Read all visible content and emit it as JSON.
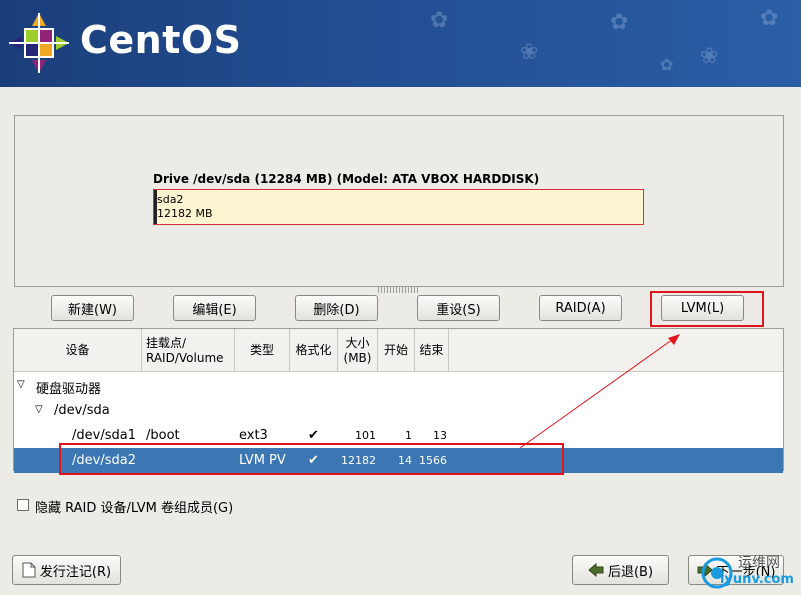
{
  "banner": {
    "brand": "CentOS"
  },
  "drive": {
    "title": "Drive /dev/sda (12284 MB) (Model: ATA VBOX HARDDISK)",
    "partition_name": "sda2",
    "partition_size": "12182 MB"
  },
  "actions": {
    "new": "新建(W)",
    "edit": "编辑(E)",
    "delete": "删除(D)",
    "reset": "重设(S)",
    "raid": "RAID(A)",
    "lvm": "LVM(L)"
  },
  "table": {
    "headers": {
      "device": "设备",
      "mount_line1": "挂载点/",
      "mount_line2": "RAID/Volume",
      "type": "类型",
      "format": "格式化",
      "size_line1": "大小",
      "size_line2": "(MB)",
      "start": "开始",
      "end": "结束"
    },
    "group": "硬盘驱动器",
    "disk": "/dev/sda",
    "rows": [
      {
        "device": "/dev/sda1",
        "mount": "/boot",
        "type": "ext3",
        "format": "✔",
        "size": "101",
        "start": "1",
        "end": "13"
      },
      {
        "device": "/dev/sda2",
        "mount": "",
        "type": "LVM PV",
        "format": "✔",
        "size": "12182",
        "start": "14",
        "end": "1566"
      }
    ]
  },
  "hide_option": "隐藏 RAID 设备/LVM 卷组成员(G)",
  "footer": {
    "release_notes": "发行注记(R)",
    "back": "后退(B)",
    "next": "下一步(N)"
  },
  "watermark": {
    "cn": "运维网",
    "url": "iyunv.com"
  },
  "icons": {
    "release_notes": "document-icon",
    "back": "arrow-left-icon",
    "next": "arrow-right-icon",
    "tree": "triangle-down-icon"
  },
  "colors": {
    "selection": "#3c77b3",
    "highlight": "#e0141f",
    "partition_fill": "#fdf5d2"
  }
}
